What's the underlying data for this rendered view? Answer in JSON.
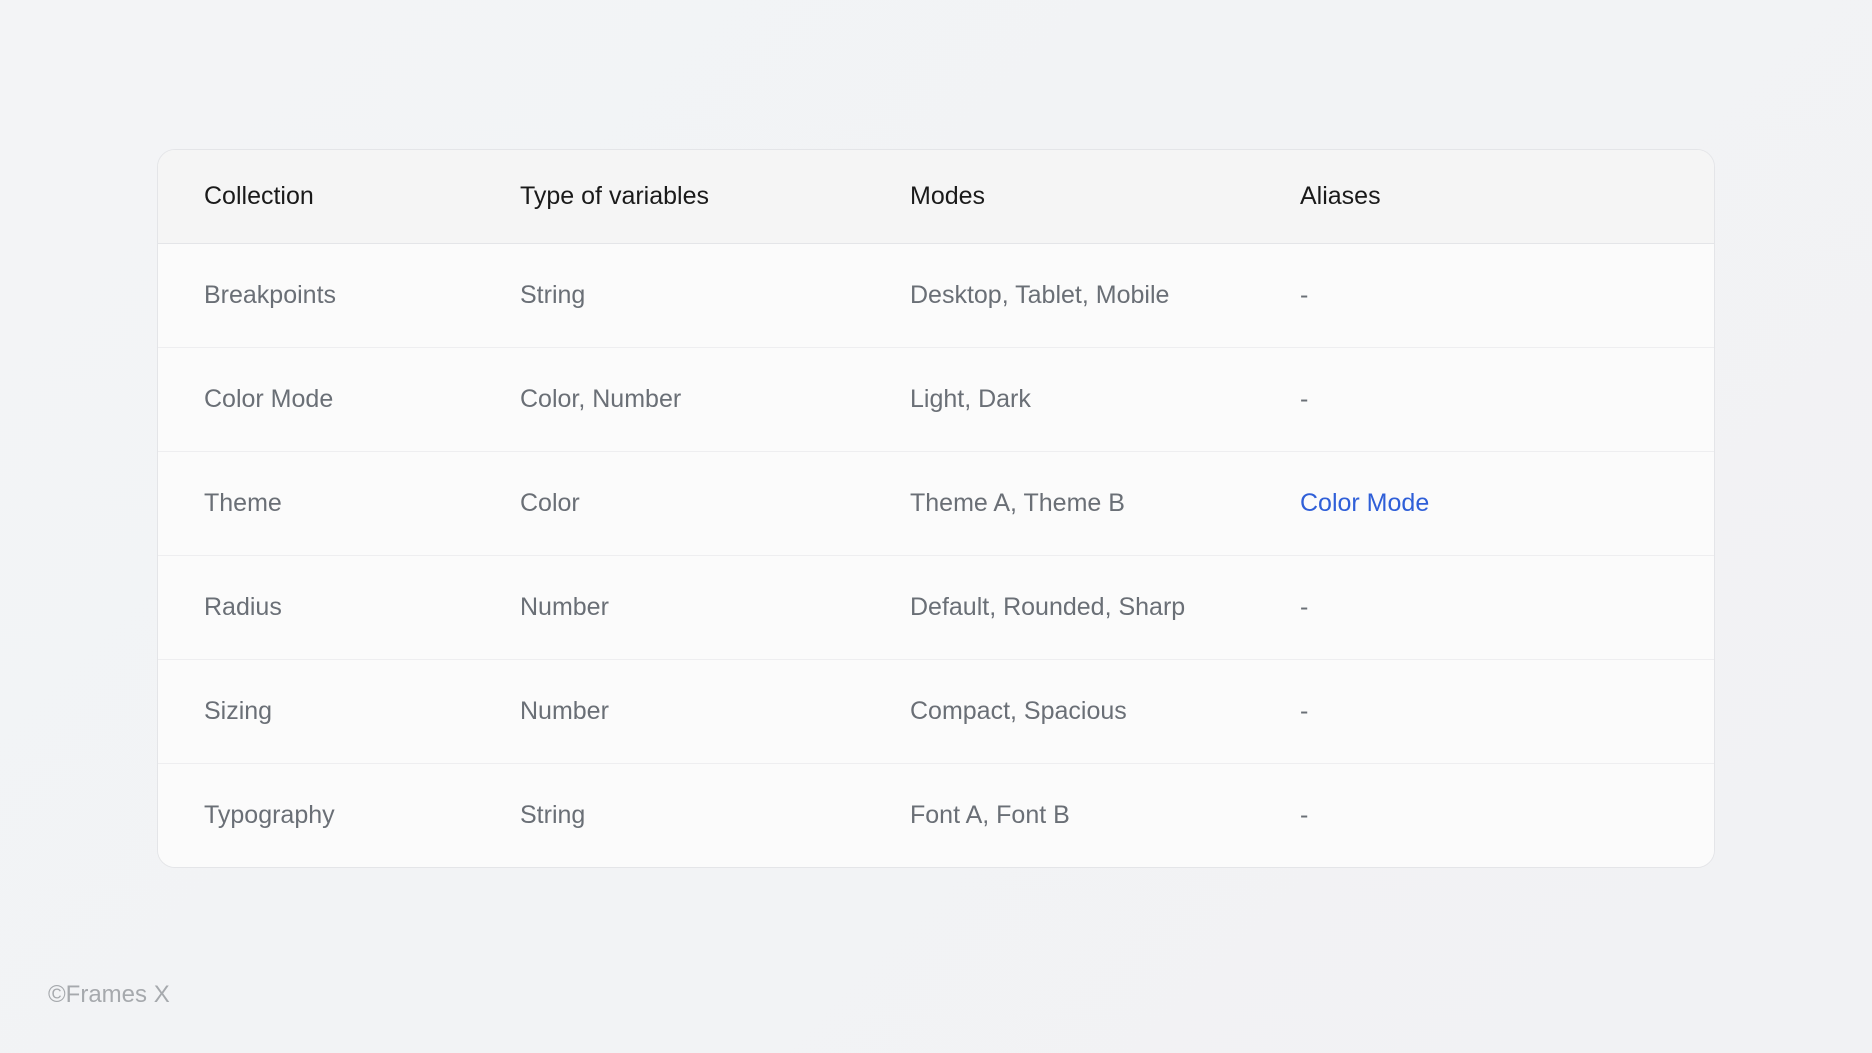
{
  "table": {
    "headers": {
      "collection": "Collection",
      "type": "Type of variables",
      "modes": "Modes",
      "aliases": "Aliases"
    },
    "rows": [
      {
        "collection": "Breakpoints",
        "type": "String",
        "modes": "Desktop, Tablet, Mobile",
        "aliases": "-",
        "alias_is_link": false
      },
      {
        "collection": "Color Mode",
        "type": "Color, Number",
        "modes": "Light, Dark",
        "aliases": "-",
        "alias_is_link": false
      },
      {
        "collection": "Theme",
        "type": "Color",
        "modes": "Theme A, Theme B",
        "aliases": "Color Mode",
        "alias_is_link": true
      },
      {
        "collection": "Radius",
        "type": "Number",
        "modes": "Default, Rounded, Sharp",
        "aliases": "-",
        "alias_is_link": false
      },
      {
        "collection": "Sizing",
        "type": "Number",
        "modes": "Compact, Spacious",
        "aliases": "-",
        "alias_is_link": false
      },
      {
        "collection": "Typography",
        "type": "String",
        "modes": "Font A, Font B",
        "aliases": "-",
        "alias_is_link": false
      }
    ]
  },
  "footer": "©Frames X"
}
